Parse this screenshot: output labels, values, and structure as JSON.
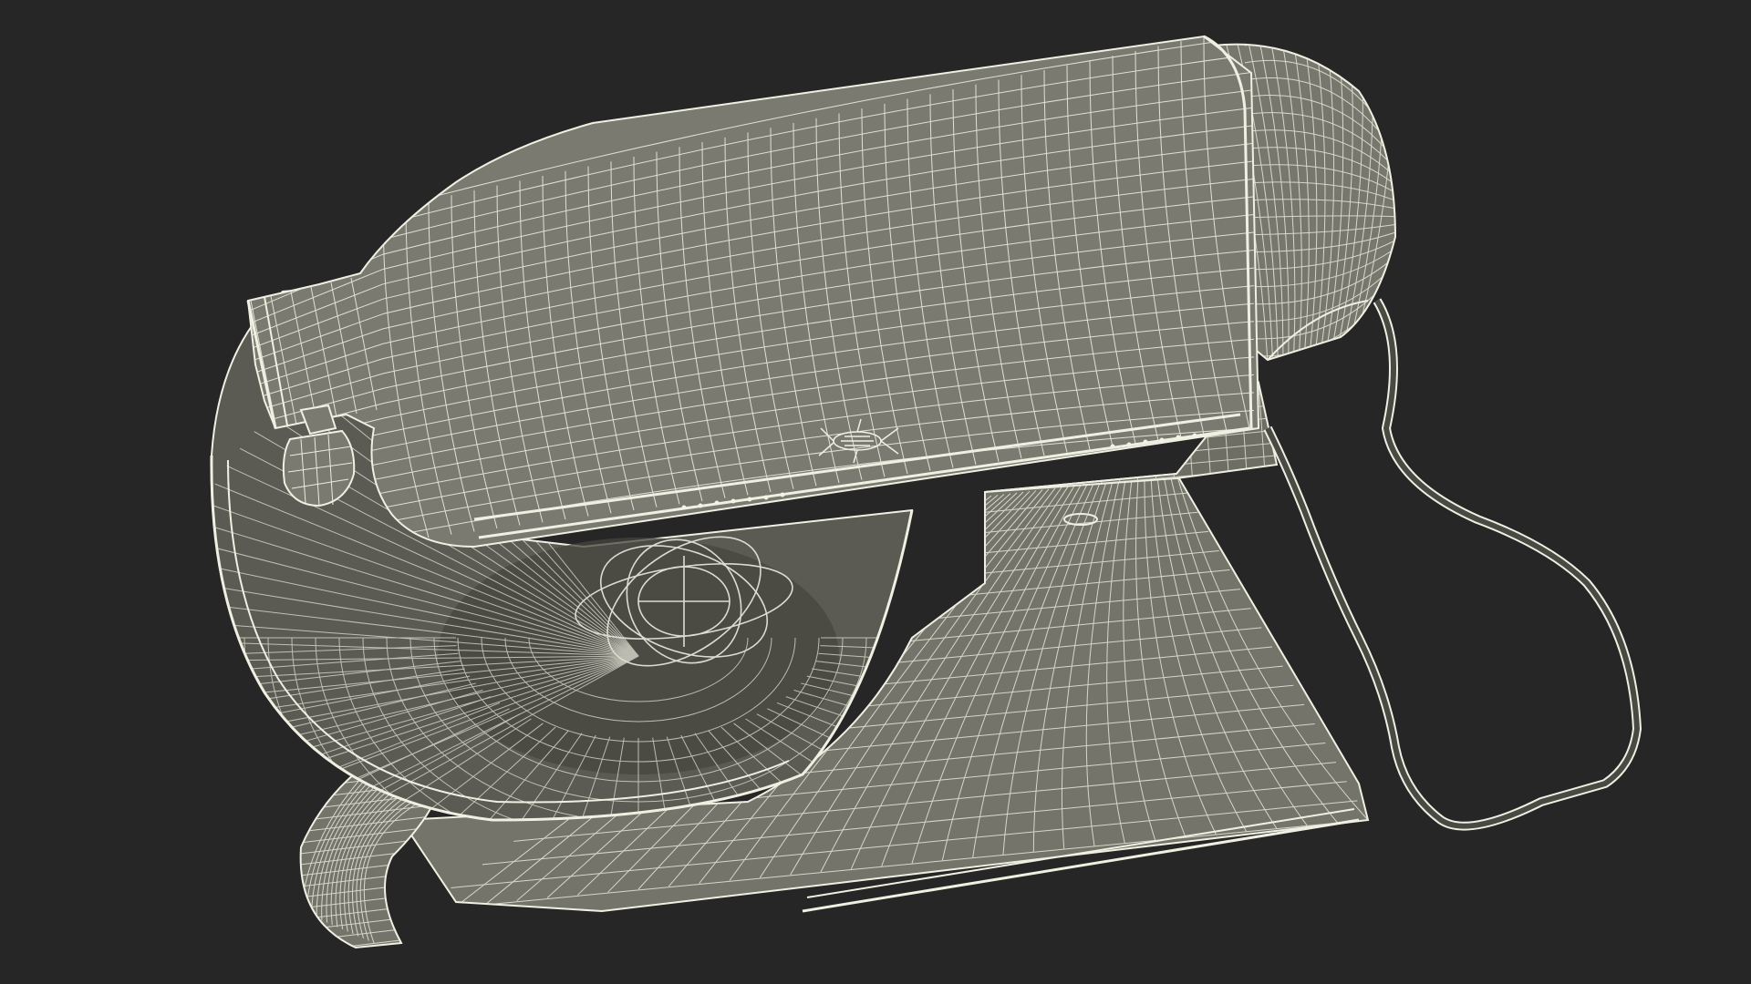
{
  "scene": {
    "background_color": "#262626",
    "mesh_fill_color": "#76766c",
    "mesh_dark_color": "#4e4e47",
    "wire_color": "#efefe2",
    "subject": "stand-mixer-wireframe"
  }
}
